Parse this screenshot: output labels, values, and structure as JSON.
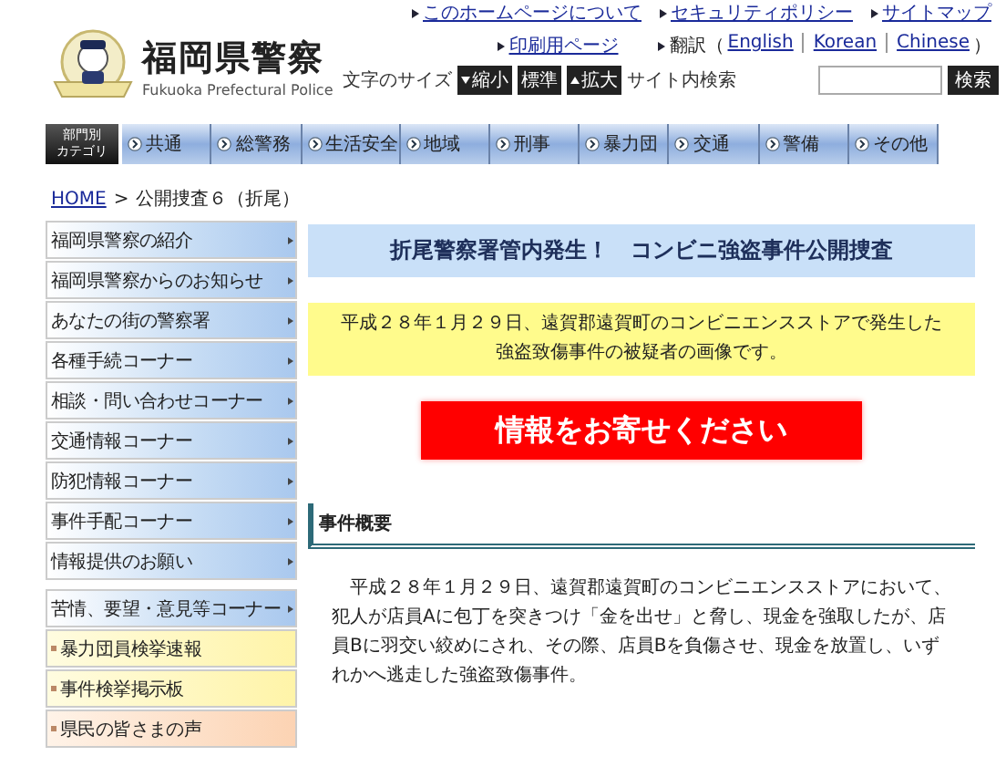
{
  "header": {
    "logo": {
      "title": "福岡県警察",
      "subtitle": "Fukuoka Prefectural Police"
    },
    "links": [
      "このホームページについて",
      "セキュリティポリシー",
      "サイトマップ"
    ],
    "print_link": "印刷用ページ",
    "translation": {
      "label": "翻訳（",
      "languages": [
        "English",
        "Korean",
        "Chinese"
      ],
      "close": "）"
    },
    "font_size": {
      "label": "文字のサイズ",
      "buttons": [
        {
          "label": "縮小",
          "kind": "down"
        },
        {
          "label": "標準",
          "kind": "plain"
        },
        {
          "label": "拡大",
          "kind": "up"
        }
      ]
    },
    "search": {
      "label": "サイト内検索",
      "button": "検索"
    }
  },
  "nav": {
    "category_label": [
      "部門別",
      "カテゴリ"
    ],
    "items": [
      "共通",
      "総警務",
      "生活安全",
      "地域",
      "刑事",
      "暴力団",
      "交通",
      "警備",
      "その他"
    ]
  },
  "breadcrumb": {
    "home": "HOME",
    "separator": ">",
    "current": "公開捜査６（折尾）"
  },
  "sidebar": {
    "items": [
      {
        "label": "福岡県警察の紹介",
        "kind": "main"
      },
      {
        "label": "福岡県警察からのお知らせ",
        "kind": "main"
      },
      {
        "label": "あなたの街の警察署",
        "kind": "main"
      },
      {
        "label": "各種手続コーナー",
        "kind": "main"
      },
      {
        "label": "相談・問い合わせコーナー",
        "kind": "main"
      },
      {
        "label": "交通情報コーナー",
        "kind": "main"
      },
      {
        "label": "防犯情報コーナー",
        "kind": "main"
      },
      {
        "label": "事件手配コーナー",
        "kind": "main"
      },
      {
        "label": "情報提供のお願い",
        "kind": "main"
      },
      {
        "label": "苦情、要望・意見等コーナー",
        "kind": "group"
      },
      {
        "label": "暴力団員検挙速報",
        "kind": "yellow"
      },
      {
        "label": "事件検挙掲示板",
        "kind": "yellow"
      },
      {
        "label": "県民の皆さまの声",
        "kind": "peach"
      }
    ]
  },
  "main": {
    "banner": "折尾警察署管内発生！　コンビニ強盗事件公開捜査",
    "notice": [
      "平成２８年１月２９日、遠賀郡遠賀町のコンビニエンスストアで発生した",
      "強盗致傷事件の被疑者の画像です。"
    ],
    "cta": "情報をお寄せください",
    "section_title": "事件概要",
    "body": "　平成２８年１月２９日、遠賀郡遠賀町のコンビニエンスストアにおいて、犯人が店員Aに包丁を突きつけ「金を出せ」と脅し、現金を強取したが、店員Bに羽交い絞めにされ、その際、店員Bを負傷させ、現金を放置し、いずれかへ逃走した強盗致傷事件。"
  }
}
